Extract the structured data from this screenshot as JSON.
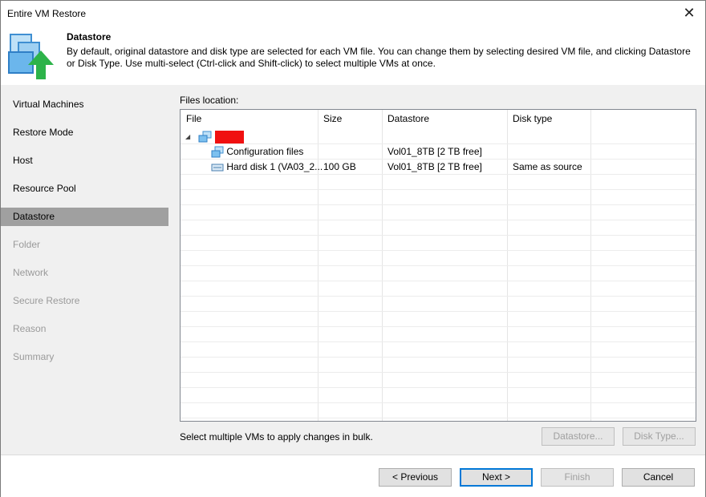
{
  "window": {
    "title": "Entire VM Restore",
    "close_glyph": "✕"
  },
  "header": {
    "title": "Datastore",
    "description": "By default, original datastore and disk type are selected for each VM file. You can change them by selecting desired VM file, and clicking Datastore or Disk Type. Use multi-select (Ctrl-click and Shift-click) to select multiple VMs at once.",
    "icon": "vm-restore-icon"
  },
  "sidebar": {
    "items": [
      {
        "label": "Virtual Machines",
        "state": "normal"
      },
      {
        "label": "Restore Mode",
        "state": "normal"
      },
      {
        "label": "Host",
        "state": "normal"
      },
      {
        "label": "Resource Pool",
        "state": "normal"
      },
      {
        "label": "Datastore",
        "state": "active"
      },
      {
        "label": "Folder",
        "state": "disabled"
      },
      {
        "label": "Network",
        "state": "disabled"
      },
      {
        "label": "Secure Restore",
        "state": "disabled"
      },
      {
        "label": "Reason",
        "state": "disabled"
      },
      {
        "label": "Summary",
        "state": "disabled"
      }
    ]
  },
  "main": {
    "files_location_label": "Files location:",
    "table": {
      "columns": [
        "File",
        "Size",
        "Datastore",
        "Disk type"
      ],
      "rows": [
        {
          "file": "",
          "size": "",
          "datastore": "",
          "disk_type": "",
          "level": 0,
          "icon": "vm-icon",
          "redacted": true
        },
        {
          "file": "Configuration files",
          "size": "",
          "datastore": "Vol01_8TB [2 TB free]",
          "disk_type": "",
          "level": 1,
          "icon": "config-files-icon"
        },
        {
          "file": "Hard disk 1 (VA03_2...",
          "size": "100 GB",
          "datastore": "Vol01_8TB [2 TB free]",
          "disk_type": "Same as source",
          "level": 1,
          "icon": "hard-disk-icon"
        }
      ]
    },
    "hint": "Select multiple VMs to apply changes in bulk.",
    "datastore_button": "Datastore...",
    "disk_type_button": "Disk Type..."
  },
  "footer": {
    "previous": "< Previous",
    "next": "Next >",
    "finish": "Finish",
    "cancel": "Cancel"
  },
  "colors": {
    "active_step_bg": "#a0a0a0",
    "panel_bg": "#f0f0f0",
    "accent": "#0078d7",
    "redaction": "#f01010",
    "arrow_green": "#2db34a"
  }
}
